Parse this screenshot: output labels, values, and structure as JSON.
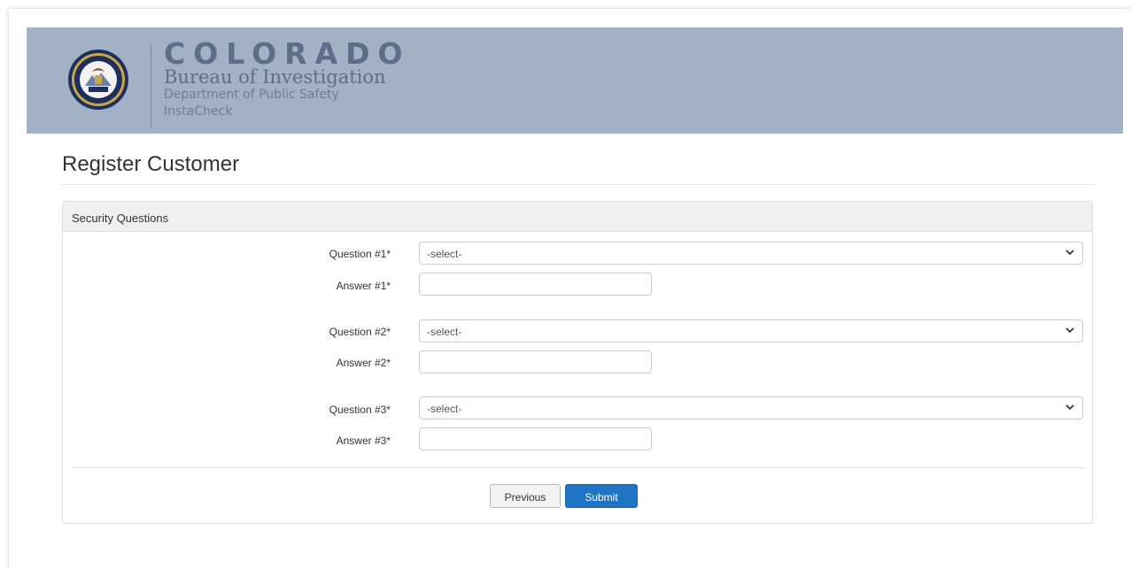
{
  "header": {
    "state_name": "COLORADO",
    "bureau_name": "Bureau of Investigation",
    "department": "Department of Public Safety",
    "app_name": "InstaCheck",
    "banner_color": "#a3b1c7"
  },
  "page": {
    "title": "Register Customer"
  },
  "panel": {
    "heading": "Security Questions"
  },
  "form": {
    "questions": [
      {
        "question_label": "Question #1*",
        "question_value": "-select-",
        "answer_label": "Answer #1*",
        "answer_value": ""
      },
      {
        "question_label": "Question #2*",
        "question_value": "-select-",
        "answer_label": "Answer #2*",
        "answer_value": ""
      },
      {
        "question_label": "Question #3*",
        "question_value": "-select-",
        "answer_label": "Answer #3*",
        "answer_value": ""
      }
    ]
  },
  "buttons": {
    "previous_label": "Previous",
    "submit_label": "Submit",
    "submit_color": "#1f74c3"
  }
}
